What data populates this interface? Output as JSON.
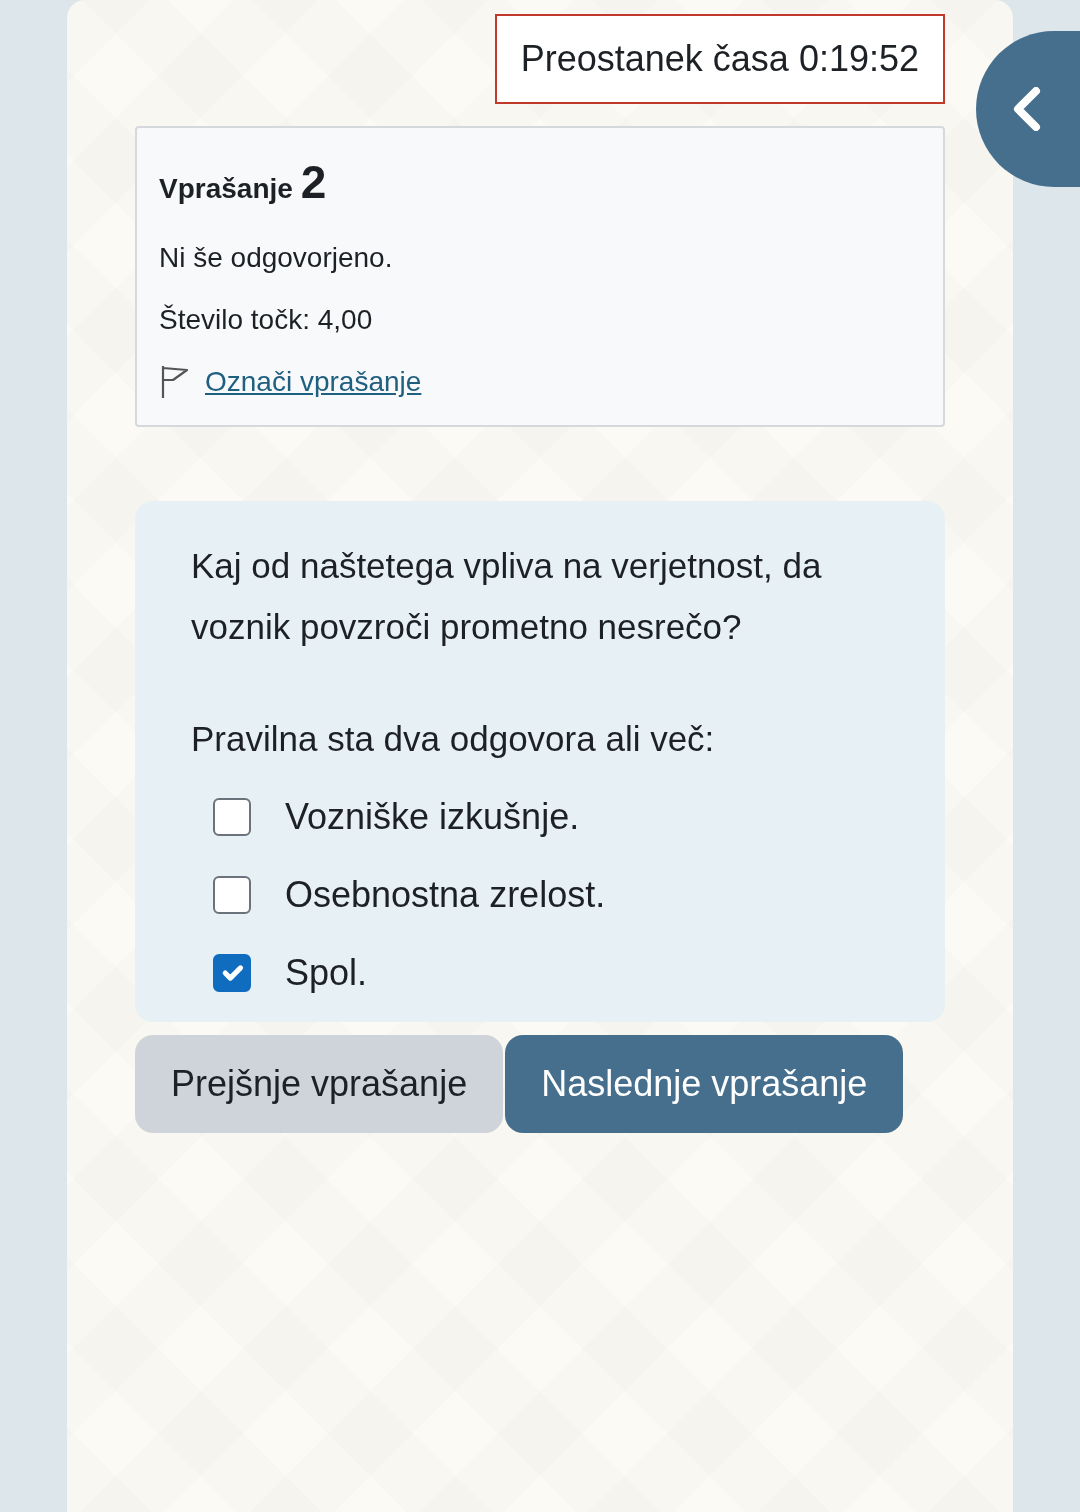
{
  "timer": {
    "text": "Preostanek časa 0:19:52"
  },
  "info": {
    "title": "Vprašanje",
    "number": "2",
    "status": "Ni še odgovorjeno.",
    "marks": "Število točk: 4,00",
    "flag_link": "Označi vprašanje",
    "flagged": false
  },
  "question": {
    "text": "Kaj od naštetega vpliva na verjetnost, da voznik povzroči prometno nesrečo?",
    "prompt": "Pravilna sta dva odgovora ali več:",
    "answers": [
      {
        "label": "Vozniške izkušnje.",
        "checked": false
      },
      {
        "label": "Osebnostna zrelost.",
        "checked": false
      },
      {
        "label": "Spol.",
        "checked": true
      }
    ]
  },
  "buttons": [
    {
      "label": "Prejšnje vprašanje",
      "kind": "secondary"
    },
    {
      "label": "Naslednje vprašanje",
      "kind": "primary"
    }
  ]
}
